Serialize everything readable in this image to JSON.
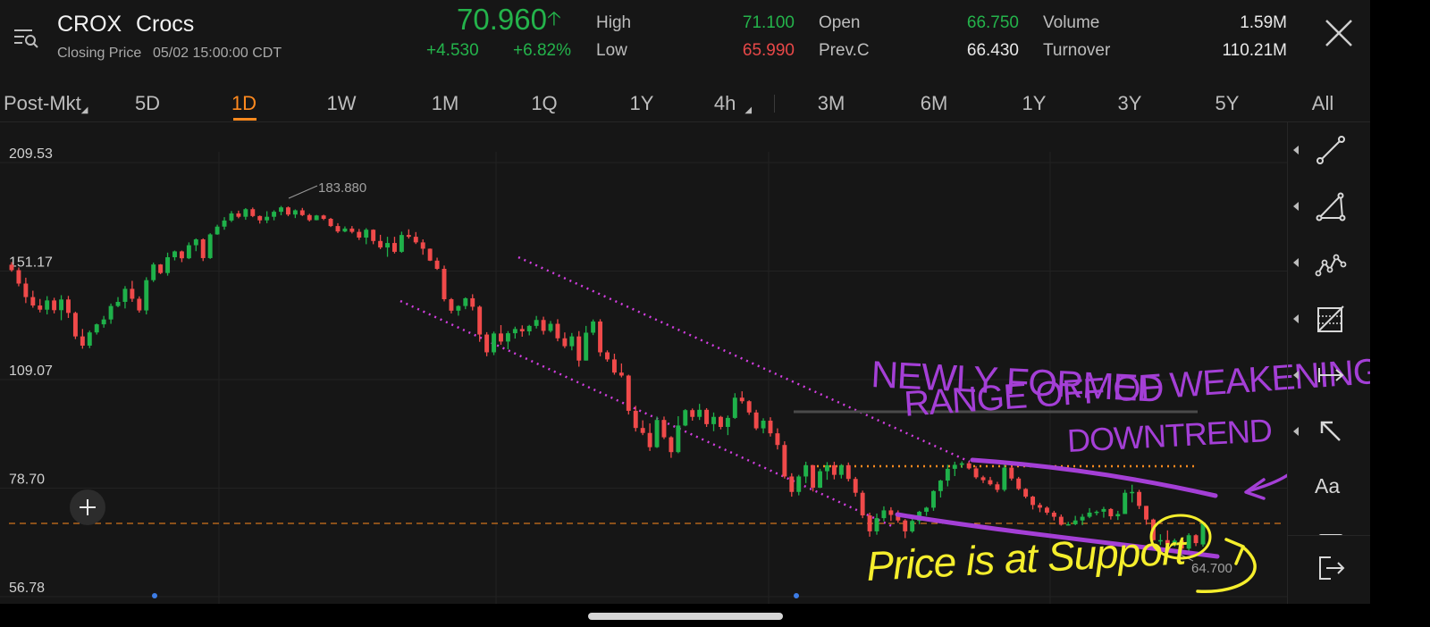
{
  "header": {
    "ticker": "CROX",
    "company": "Crocs",
    "closing_label": "Closing Price",
    "closing_time": "05/02 15:00:00 CDT",
    "price": "70.960",
    "change": "+4.530",
    "change_pct": "+6.82%",
    "stats": [
      {
        "label": "High",
        "value": "71.100",
        "color": "#24b34b"
      },
      {
        "label": "Low",
        "value": "65.990",
        "color": "#e84848"
      },
      {
        "label": "Open",
        "value": "66.750",
        "color": "#24b34b"
      },
      {
        "label": "Prev.C",
        "value": "66.430",
        "color": "#e8e8e8"
      },
      {
        "label": "Volume",
        "value": "1.59M",
        "color": "#e8e8e8"
      },
      {
        "label": "Turnover",
        "value": "110.21M",
        "color": "#e8e8e8"
      }
    ],
    "menu_icon": "list-search-icon",
    "close_icon": "close-icon"
  },
  "tabs": [
    "Post-Mkt",
    "5D",
    "1D",
    "1W",
    "1M",
    "1Q",
    "1Y",
    "4h",
    "3M",
    "6M",
    "1Y",
    "3Y",
    "5Y",
    "All"
  ],
  "active_tab": "1D",
  "toolbar": [
    {
      "name": "trend-line-tool",
      "icon": "line-tool-icon"
    },
    {
      "name": "triangle-tool",
      "icon": "triangle-tool-icon"
    },
    {
      "name": "wave-pattern-tool",
      "icon": "wave-pattern-icon"
    },
    {
      "name": "fibonacci-tool",
      "icon": "fib-grid-icon"
    },
    {
      "name": "horizontal-ray-tool",
      "icon": "horizontal-ray-icon"
    },
    {
      "name": "arrow-tool",
      "icon": "arrow-icon"
    },
    {
      "name": "text-tool",
      "icon": "text-icon",
      "label": "Aa"
    },
    {
      "name": "rectangle-tool",
      "icon": "rectangle-icon"
    },
    {
      "name": "exit-drawing-tool",
      "icon": "exit-icon"
    }
  ],
  "chart_data": {
    "type": "candlestick",
    "y_axis": {
      "scale": "log",
      "labels": [
        "209.53",
        "151.17",
        "109.07",
        "78.70",
        "56.78"
      ],
      "range": [
        56.78,
        209.53
      ]
    },
    "annotations_text": {
      "high": "183.880",
      "low": "64.700"
    },
    "last_price_line": 70.96,
    "resistance_line": 84.5,
    "gray_line": 98,
    "colors": {
      "up": "#1fb14a",
      "down": "#f04a4a",
      "magenta": "#d23ee0",
      "orange": "#ff8a1f",
      "yellow": "#f5ee2c",
      "purple": "#a43fd6"
    },
    "candles": [
      [
        154.1,
        155.3,
        150.9,
        151.6
      ],
      [
        151.6,
        152.8,
        144.4,
        145.6
      ],
      [
        145.6,
        148.2,
        137.3,
        139.8
      ],
      [
        139.8,
        142.5,
        135.4,
        136.3
      ],
      [
        136.3,
        139.0,
        133.5,
        134.6
      ],
      [
        134.6,
        140.2,
        132.7,
        138.4
      ],
      [
        138.4,
        139.5,
        133.1,
        134.4
      ],
      [
        134.4,
        140.6,
        130.4,
        138.8
      ],
      [
        138.8,
        140.3,
        131.3,
        133.3
      ],
      [
        133.3,
        133.8,
        123.2,
        124.2
      ],
      [
        124.2,
        127.0,
        119.7,
        120.8
      ],
      [
        120.8,
        126.4,
        119.9,
        125.7
      ],
      [
        125.7,
        129.1,
        124.9,
        128.8
      ],
      [
        128.8,
        132.1,
        127.5,
        130.7
      ],
      [
        130.7,
        137.1,
        129.0,
        136.1
      ],
      [
        136.1,
        139.8,
        135.6,
        137.8
      ],
      [
        137.8,
        144.5,
        135.1,
        143.3
      ],
      [
        143.3,
        146.8,
        137.8,
        139.1
      ],
      [
        139.1,
        140.1,
        133.4,
        134.3
      ],
      [
        134.3,
        148.4,
        132.7,
        147.1
      ],
      [
        147.1,
        155.1,
        146.3,
        154.2
      ],
      [
        154.2,
        154.4,
        149.8,
        150.3
      ],
      [
        150.3,
        159.8,
        149.1,
        157.6
      ],
      [
        157.6,
        160.8,
        156.1,
        160.4
      ],
      [
        160.4,
        160.8,
        155.3,
        157.1
      ],
      [
        157.1,
        164.8,
        156.7,
        163.4
      ],
      [
        163.4,
        166.8,
        160.5,
        166.3
      ],
      [
        166.3,
        166.8,
        155.8,
        157.2
      ],
      [
        157.2,
        169.4,
        156.8,
        168.8
      ],
      [
        168.8,
        173.8,
        168.6,
        172.8
      ],
      [
        172.8,
        177.8,
        171.2,
        176.0
      ],
      [
        176.0,
        181.1,
        175.2,
        179.8
      ],
      [
        179.8,
        181.3,
        177.2,
        178.0
      ],
      [
        178.0,
        182.7,
        176.4,
        182.1
      ],
      [
        182.1,
        183.0,
        177.8,
        178.4
      ],
      [
        178.4,
        178.7,
        174.4,
        176.1
      ],
      [
        176.1,
        181.0,
        174.6,
        178.0
      ],
      [
        178.0,
        181.5,
        176.1,
        180.7
      ],
      [
        180.7,
        183.9,
        178.8,
        183.1
      ],
      [
        183.1,
        183.6,
        178.3,
        179.2
      ],
      [
        179.2,
        182.0,
        177.3,
        181.5
      ],
      [
        181.5,
        182.8,
        178.4,
        178.9
      ],
      [
        178.9,
        179.6,
        175.5,
        176.2
      ],
      [
        176.2,
        179.0,
        176.1,
        178.7
      ],
      [
        178.7,
        179.1,
        176.2,
        176.9
      ],
      [
        176.9,
        177.4,
        172.6,
        173.1
      ],
      [
        173.1,
        174.6,
        169.5,
        170.3
      ],
      [
        170.3,
        172.9,
        169.9,
        171.8
      ],
      [
        171.8,
        173.1,
        169.3,
        170.1
      ],
      [
        170.1,
        171.6,
        166.0,
        167.2
      ],
      [
        167.2,
        172.0,
        163.9,
        171.2
      ],
      [
        171.2,
        171.4,
        163.9,
        165.5
      ],
      [
        165.5,
        168.6,
        161.5,
        162.3
      ],
      [
        162.3,
        167.6,
        157.8,
        164.5
      ],
      [
        164.5,
        167.6,
        159.4,
        160.2
      ],
      [
        160.2,
        170.2,
        159.7,
        168.5
      ],
      [
        168.5,
        171.4,
        166.7,
        167.6
      ],
      [
        167.6,
        170.0,
        164.0,
        164.8
      ],
      [
        164.8,
        166.3,
        158.8,
        161.7
      ],
      [
        161.7,
        161.8,
        155.8,
        156.0
      ],
      [
        156.0,
        157.4,
        151.7,
        152.2
      ],
      [
        152.2,
        153.7,
        138.0,
        138.9
      ],
      [
        138.9,
        139.4,
        133.1,
        134.2
      ],
      [
        134.2,
        136.4,
        132.2,
        136.1
      ],
      [
        136.1,
        139.7,
        134.8,
        139.3
      ],
      [
        139.3,
        141.0,
        134.3,
        135.8
      ],
      [
        135.8,
        136.3,
        122.2,
        124.9
      ],
      [
        124.9,
        125.8,
        117.0,
        118.4
      ],
      [
        118.4,
        126.0,
        117.4,
        125.3
      ],
      [
        125.3,
        128.5,
        121.1,
        122.3
      ],
      [
        122.3,
        126.2,
        119.5,
        125.4
      ],
      [
        125.4,
        127.9,
        123.4,
        127.0
      ],
      [
        127.0,
        128.4,
        124.1,
        126.1
      ],
      [
        126.1,
        128.6,
        124.6,
        128.2
      ],
      [
        128.2,
        132.1,
        127.2,
        130.5
      ],
      [
        130.5,
        131.8,
        124.9,
        126.3
      ],
      [
        126.3,
        130.1,
        125.7,
        129.0
      ],
      [
        129.0,
        130.8,
        122.4,
        123.5
      ],
      [
        123.5,
        125.7,
        119.9,
        120.6
      ],
      [
        120.6,
        125.5,
        119.1,
        124.2
      ],
      [
        124.2,
        126.2,
        113.4,
        115.5
      ],
      [
        115.5,
        128.2,
        115.5,
        125.6
      ],
      [
        125.6,
        130.7,
        124.7,
        129.9
      ],
      [
        129.9,
        130.8,
        117.0,
        118.4
      ],
      [
        118.4,
        119.1,
        115.1,
        115.9
      ],
      [
        115.9,
        117.9,
        110.7,
        111.4
      ],
      [
        111.4,
        114.5,
        109.8,
        110.4
      ],
      [
        110.4,
        110.7,
        98.2,
        99.3
      ],
      [
        99.3,
        100.8,
        93.3,
        94.3
      ],
      [
        94.3,
        96.5,
        92.3,
        92.9
      ],
      [
        92.9,
        95.6,
        88.0,
        89.0
      ],
      [
        89.0,
        97.6,
        88.8,
        96.6
      ],
      [
        96.6,
        97.6,
        91.2,
        91.7
      ],
      [
        91.7,
        92.0,
        86.2,
        87.7
      ],
      [
        87.7,
        97.7,
        87.4,
        95.0
      ],
      [
        95.0,
        99.8,
        94.8,
        99.5
      ],
      [
        99.5,
        100.0,
        96.4,
        97.5
      ],
      [
        97.5,
        101.4,
        96.6,
        99.6
      ],
      [
        99.6,
        100.1,
        94.6,
        95.4
      ],
      [
        95.4,
        98.8,
        93.4,
        97.5
      ],
      [
        97.5,
        97.8,
        93.9,
        94.6
      ],
      [
        94.6,
        97.9,
        92.3,
        97.2
      ],
      [
        97.2,
        104.7,
        96.9,
        103.3
      ],
      [
        103.3,
        105.3,
        101.5,
        102.2
      ],
      [
        102.2,
        102.5,
        98.1,
        98.8
      ],
      [
        98.8,
        99.6,
        93.7,
        94.2
      ],
      [
        94.2,
        97.1,
        92.8,
        96.4
      ],
      [
        96.4,
        97.4,
        91.9,
        92.8
      ],
      [
        92.8,
        94.2,
        88.4,
        89.6
      ],
      [
        89.6,
        90.6,
        81.0,
        81.5
      ],
      [
        81.5,
        82.3,
        76.7,
        77.8
      ],
      [
        77.8,
        81.9,
        77.0,
        81.5
      ],
      [
        81.5,
        85.2,
        79.9,
        84.3
      ],
      [
        84.3,
        84.4,
        77.9,
        78.8
      ],
      [
        78.8,
        83.4,
        78.7,
        82.8
      ],
      [
        82.8,
        85.1,
        80.7,
        84.3
      ],
      [
        84.3,
        85.2,
        80.8,
        81.9
      ],
      [
        81.9,
        84.6,
        81.0,
        84.3
      ],
      [
        84.3,
        85.0,
        80.3,
        80.9
      ],
      [
        80.9,
        81.4,
        76.7,
        77.6
      ],
      [
        77.6,
        78.1,
        71.9,
        72.5
      ],
      [
        72.5,
        73.1,
        68.0,
        69.1
      ],
      [
        69.1,
        72.9,
        68.4,
        71.9
      ],
      [
        71.9,
        74.5,
        71.2,
        73.6
      ],
      [
        73.6,
        74.3,
        71.3,
        72.6
      ],
      [
        72.6,
        73.6,
        70.9,
        71.4
      ],
      [
        71.4,
        71.7,
        67.7,
        69.1
      ],
      [
        69.1,
        72.6,
        68.8,
        71.3
      ],
      [
        71.3,
        73.5,
        70.6,
        73.3
      ],
      [
        73.3,
        74.4,
        72.4,
        74.2
      ],
      [
        74.2,
        78.2,
        73.5,
        78.0
      ],
      [
        78.0,
        80.7,
        76.5,
        80.5
      ],
      [
        80.5,
        84.4,
        79.1,
        83.4
      ],
      [
        83.4,
        85.2,
        81.6,
        84.4
      ],
      [
        84.4,
        85.3,
        83.6,
        84.8
      ],
      [
        84.8,
        85.2,
        83.2,
        83.5
      ],
      [
        83.5,
        84.1,
        80.9,
        81.3
      ],
      [
        81.3,
        81.7,
        79.9,
        80.6
      ],
      [
        80.6,
        81.4,
        79.3,
        79.6
      ],
      [
        79.6,
        80.2,
        77.7,
        78.3
      ],
      [
        78.3,
        85.4,
        77.9,
        83.7
      ],
      [
        83.7,
        84.2,
        80.5,
        81.0
      ],
      [
        81.0,
        81.4,
        78.2,
        78.5
      ],
      [
        78.5,
        78.7,
        76.3,
        76.7
      ],
      [
        76.7,
        76.9,
        73.8,
        74.8
      ],
      [
        74.8,
        75.3,
        73.2,
        74.2
      ],
      [
        74.2,
        74.5,
        72.6,
        73.1
      ],
      [
        73.1,
        73.5,
        71.4,
        72.2
      ],
      [
        72.2,
        72.7,
        70.3,
        70.5
      ],
      [
        70.5,
        71.1,
        70.3,
        70.6
      ],
      [
        70.6,
        72.4,
        70.4,
        71.4
      ],
      [
        71.4,
        72.8,
        70.4,
        72.2
      ],
      [
        72.2,
        74.1,
        71.9,
        73.1
      ],
      [
        73.1,
        73.6,
        72.5,
        73.3
      ],
      [
        73.3,
        74.4,
        72.0,
        73.9
      ],
      [
        73.9,
        74.1,
        71.6,
        72.3
      ],
      [
        72.3,
        73.5,
        71.5,
        72.8
      ],
      [
        72.8,
        78.3,
        72.8,
        77.6
      ],
      [
        77.6,
        79.5,
        75.4,
        77.8
      ],
      [
        77.8,
        78.3,
        73.9,
        74.6
      ],
      [
        74.6,
        74.6,
        70.5,
        71.6
      ],
      [
        71.6,
        71.8,
        67.2,
        67.3
      ],
      [
        67.3,
        68.5,
        66.3,
        67.3
      ],
      [
        67.3,
        69.3,
        66.1,
        66.4
      ],
      [
        66.4,
        67.6,
        66.0,
        67.2
      ],
      [
        67.2,
        67.3,
        64.7,
        65.6
      ],
      [
        65.6,
        68.7,
        65.1,
        68.3
      ],
      [
        68.3,
        68.5,
        66.1,
        66.7
      ],
      [
        66.43,
        71.1,
        65.99,
        70.96
      ]
    ]
  }
}
